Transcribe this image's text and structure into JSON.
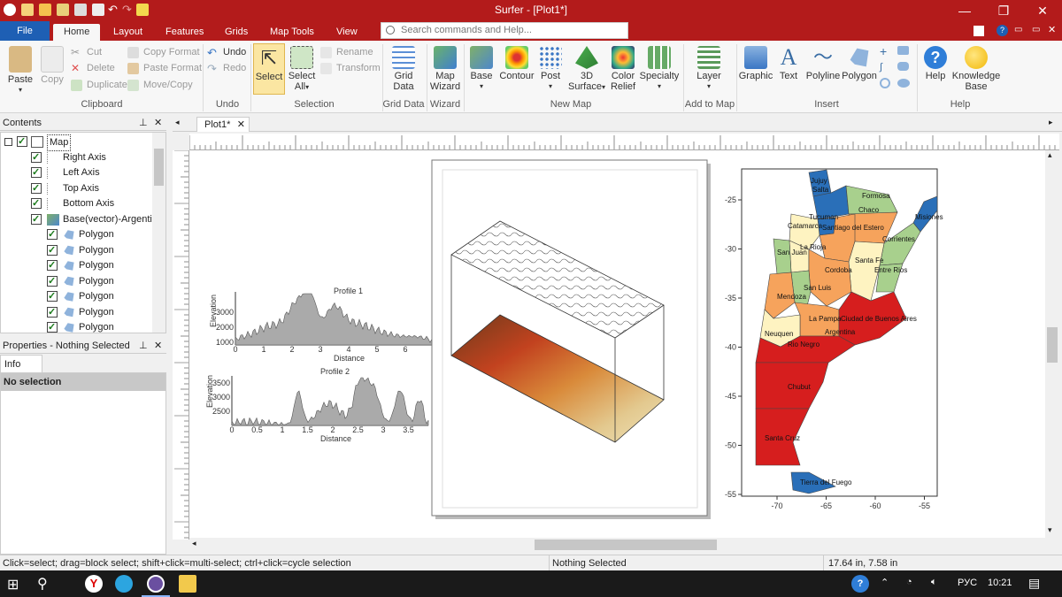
{
  "app": {
    "title": "Surfer - [Plot1*]"
  },
  "tabs": [
    "File",
    "Home",
    "Layout",
    "Features",
    "Grids",
    "Map Tools",
    "View"
  ],
  "search": {
    "placeholder": "Search commands and Help..."
  },
  "ribbon": {
    "clipboard": {
      "paste": "Paste",
      "copy": "Copy",
      "cut": "Cut",
      "delete": "Delete",
      "duplicate": "Duplicate",
      "copy_format": "Copy Format",
      "paste_format": "Paste Format",
      "move_copy": "Move/Copy",
      "group": "Clipboard"
    },
    "undo": {
      "undo": "Undo",
      "redo": "Redo",
      "group": "Undo"
    },
    "selection": {
      "select": "Select",
      "select_all": "Select All",
      "rename": "Rename",
      "transform": "Transform",
      "group": "Selection"
    },
    "grid_data": {
      "label": "Grid Data",
      "group": "Grid Data"
    },
    "wizard": {
      "label": "Map Wizard",
      "group": "Wizard"
    },
    "new_map": {
      "base": "Base",
      "contour": "Contour",
      "post": "Post",
      "surface": "3D Surface",
      "relief": "Color Relief",
      "specialty": "Specialty",
      "group": "New Map"
    },
    "add_to_map": {
      "layer": "Layer",
      "group": "Add to Map"
    },
    "insert": {
      "graphic": "Graphic",
      "text": "Text",
      "polyline": "Polyline",
      "polygon": "Polygon",
      "group": "Insert"
    },
    "help": {
      "help": "Help",
      "kb": "Knowledge Base",
      "group": "Help"
    }
  },
  "contents": {
    "header": "Contents",
    "items": [
      {
        "label": "Map",
        "checked": true,
        "level": 0
      },
      {
        "label": "Right Axis",
        "checked": true,
        "level": 1
      },
      {
        "label": "Left Axis",
        "checked": true,
        "level": 1
      },
      {
        "label": "Top Axis",
        "checked": true,
        "level": 1
      },
      {
        "label": "Bottom Axis",
        "checked": true,
        "level": 1
      },
      {
        "label": "Base(vector)-Argenti",
        "checked": true,
        "level": 1
      },
      {
        "label": "Polygon",
        "checked": true,
        "level": 2
      },
      {
        "label": "Polygon",
        "checked": true,
        "level": 2
      },
      {
        "label": "Polygon",
        "checked": true,
        "level": 2
      },
      {
        "label": "Polygon",
        "checked": true,
        "level": 2
      },
      {
        "label": "Polygon",
        "checked": true,
        "level": 2
      },
      {
        "label": "Polygon",
        "checked": true,
        "level": 2
      },
      {
        "label": "Polygon",
        "checked": true,
        "level": 2
      }
    ]
  },
  "properties": {
    "header": "Properties - Nothing Selected",
    "tab": "Info",
    "selection": "No selection"
  },
  "doc": {
    "tab": "Plot1*"
  },
  "plot": {
    "profile1": {
      "title": "Profile 1",
      "xlabel": "Distance",
      "ylabel": "Elevation",
      "yticks": [
        "3000",
        "2000",
        "1000"
      ],
      "xticks": [
        "0",
        "1",
        "2",
        "3",
        "4",
        "5",
        "6"
      ]
    },
    "profile2": {
      "title": "Profile 2",
      "xlabel": "Distance",
      "ylabel": "Elevation",
      "yticks": [
        "3500",
        "3000",
        "2500"
      ],
      "xticks": [
        "0",
        "0.5",
        "1",
        "1.5",
        "2",
        "2.5",
        "3",
        "3.5"
      ]
    },
    "map": {
      "yticks": [
        "-25",
        "-30",
        "-35",
        "-40",
        "-45",
        "-50",
        "-55"
      ],
      "xticks": [
        "-70",
        "-65",
        "-60",
        "-55"
      ],
      "provinces": [
        "Jujuy",
        "Salta",
        "Formosa",
        "Chaco",
        "Misiones",
        "Tucuman",
        "Catamarca",
        "Santiago del Estero",
        "Corrientes",
        "La Rioja",
        "San Juan",
        "Santa Fe",
        "Entre Rios",
        "Cordoba",
        "San Luis",
        "Mendoza",
        "La Pampa",
        "Ciudad de Buenos Aires",
        "Argentina",
        "Neuquen",
        "Rio Negro",
        "Chubut",
        "Santa Cruz",
        "Tierra del Fuego"
      ]
    }
  },
  "status": {
    "hint": "Click=select; drag=block select; shift+click=multi-select; ctrl+click=cycle selection",
    "selection": "Nothing Selected",
    "coords": "17.64 in, 7.58 in"
  },
  "taskbar": {
    "lang": "РУС",
    "time": "10:21"
  }
}
